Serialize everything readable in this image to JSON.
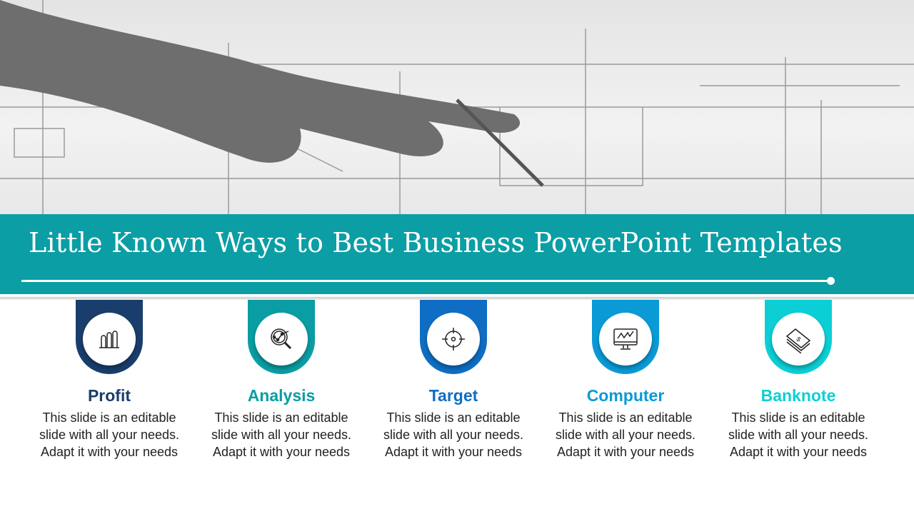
{
  "header": {
    "title": "Little Known Ways to Best Business PowerPoint Templates",
    "banner_color": "#0b9ea5"
  },
  "items": [
    {
      "title": "Profit",
      "icon": "bar-chart-icon",
      "color": "#1a3e6b",
      "description": "This slide is an editable slide with all your needs. Adapt it with your needs"
    },
    {
      "title": "Analysis",
      "icon": "magnifier-analysis-icon",
      "color": "#0a9da3",
      "description": "This slide is an editable slide with all your needs. Adapt it with your needs"
    },
    {
      "title": "Target",
      "icon": "crosshair-target-icon",
      "color": "#0f6ec4",
      "description": "This slide is an editable slide with all your needs. Adapt it with your needs"
    },
    {
      "title": "Computer",
      "icon": "monitor-chart-icon",
      "color": "#0a9ad6",
      "description": "This slide is an editable slide with all your needs. Adapt it with your needs"
    },
    {
      "title": "Banknote",
      "icon": "banknote-stack-icon",
      "color": "#0ccfd6",
      "description": "This slide is an editable slide with all your needs. Adapt it with your needs"
    }
  ]
}
